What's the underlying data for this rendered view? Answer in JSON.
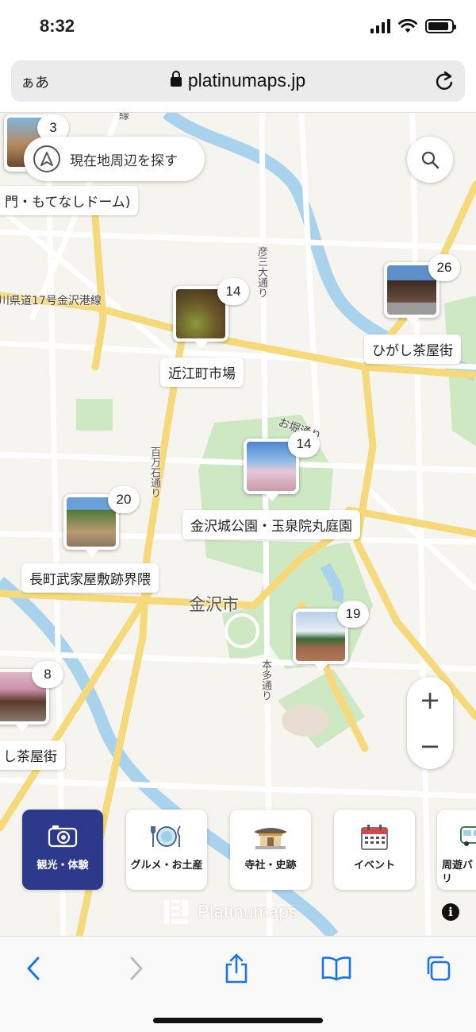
{
  "status_bar": {
    "time": "8:32"
  },
  "browser": {
    "text_size_label": "ぁあ",
    "url": "platinumaps.jp"
  },
  "map": {
    "search_nearby_label": "現在地周辺を探す",
    "city_label": "金沢市",
    "road_labels": [
      "百万石通り",
      "本多通り",
      "お堀通り",
      "彦三大通り",
      "線"
    ],
    "road_label_h": "川県道17号金沢港線",
    "spots": [
      {
        "count": "3",
        "label": "門・もてなしドーム)"
      },
      {
        "count": "14",
        "label": "近江町市場"
      },
      {
        "count": "26",
        "label": "ひがし茶屋街"
      },
      {
        "count": "14",
        "label": "金沢城公園・玉泉院丸庭園"
      },
      {
        "count": "20",
        "label": "長町武家屋敷跡界隈"
      },
      {
        "count": "19",
        "label": ""
      },
      {
        "count": "8",
        "label": "し茶屋街"
      }
    ],
    "zoom_in": "+",
    "zoom_out": "−"
  },
  "categories": [
    {
      "label": "観光・体験",
      "icon": "camera-icon",
      "active": true
    },
    {
      "label": "グルメ・お土産",
      "icon": "dining-icon",
      "active": false
    },
    {
      "label": "寺社・史跡",
      "icon": "shrine-icon",
      "active": false
    },
    {
      "label": "イベント",
      "icon": "calendar-icon",
      "active": false
    },
    {
      "label": "周遊バ\nリ",
      "icon": "bus-icon",
      "active": false
    }
  ],
  "brand": {
    "name": "Platinumaps"
  },
  "info_label": "i",
  "colors": {
    "accent": "#2d3a8c",
    "water": "#a9d3ec",
    "park": "#cfe8c4",
    "major_road": "#f5d97a"
  }
}
